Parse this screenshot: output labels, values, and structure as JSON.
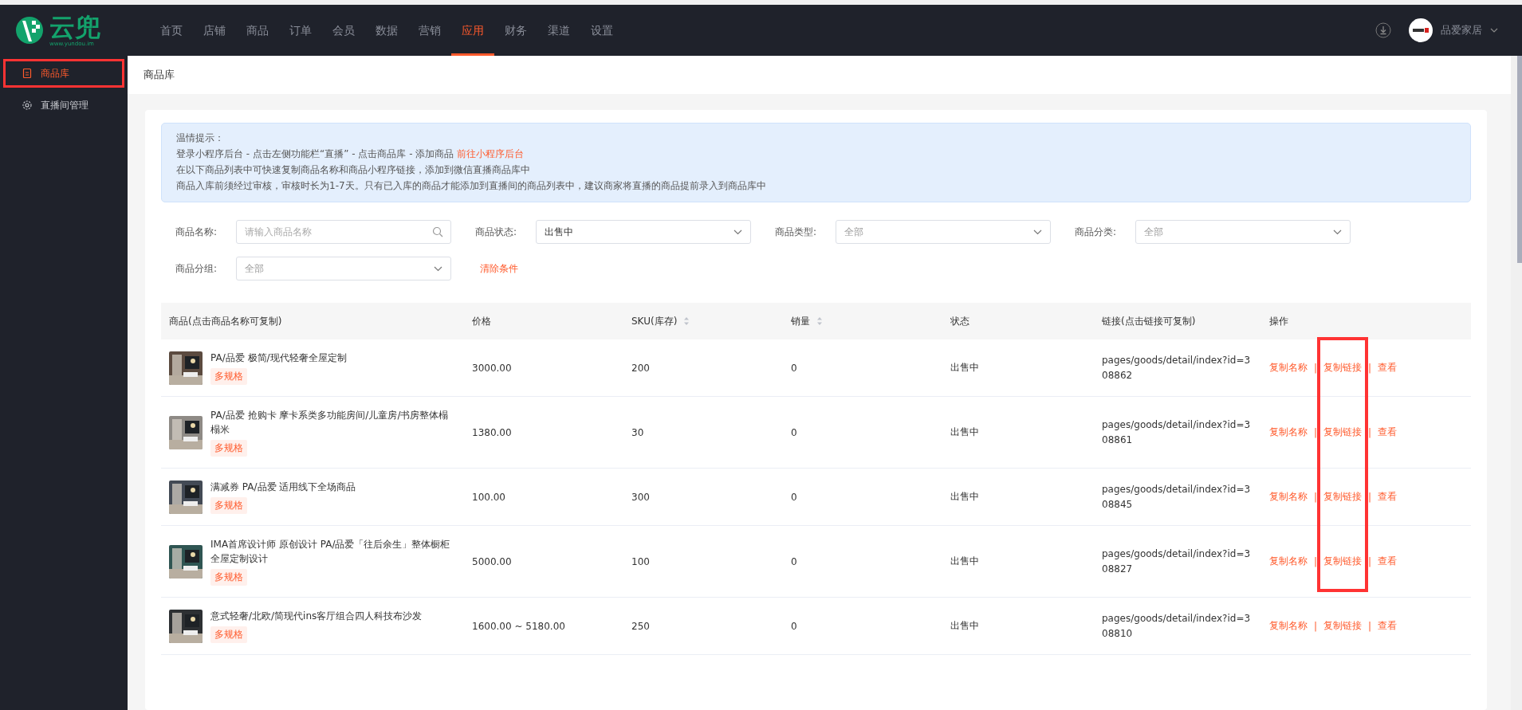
{
  "logo": {
    "name": "云兜",
    "site": "www.yundou.im"
  },
  "top_nav": [
    {
      "label": "首页",
      "selected": false
    },
    {
      "label": "店铺",
      "selected": false
    },
    {
      "label": "商品",
      "selected": false
    },
    {
      "label": "订单",
      "selected": false
    },
    {
      "label": "会员",
      "selected": false
    },
    {
      "label": "数据",
      "selected": false
    },
    {
      "label": "营销",
      "selected": false
    },
    {
      "label": "应用",
      "selected": true
    },
    {
      "label": "财务",
      "selected": false
    },
    {
      "label": "渠道",
      "selected": false
    },
    {
      "label": "设置",
      "selected": false
    }
  ],
  "account": {
    "name": "品爱家居"
  },
  "sidebar": {
    "items": [
      {
        "label": "商品库",
        "selected": true,
        "highlighted": true
      },
      {
        "label": "直播间管理",
        "selected": false,
        "highlighted": false
      }
    ]
  },
  "page_title": "商品库",
  "notice": {
    "title": "温情提示：",
    "lines": [
      {
        "text": "登录小程序后台 - 点击左侧功能栏“直播” - 点击商品库 - 添加商品",
        "link": "前往小程序后台"
      },
      {
        "text": "在以下商品列表中可快速复制商品名称和商品小程序链接，添加到微信直播商品库中"
      },
      {
        "text": "商品入库前须经过审核，审核时长为1-7天。只有已入库的商品才能添加到直播间的商品列表中，建议商家将直播的商品提前录入到商品库中"
      }
    ]
  },
  "filters": [
    {
      "label": "商品名称:",
      "kind": "search",
      "placeholder": "请输入商品名称"
    },
    {
      "label": "商品状态:",
      "kind": "select",
      "value": "出售中"
    },
    {
      "label": "商品类型:",
      "kind": "select",
      "placeholder": "全部"
    },
    {
      "label": "商品分类:",
      "kind": "select",
      "placeholder": "全部"
    },
    {
      "label": "商品分组:",
      "kind": "select",
      "placeholder": "全部"
    }
  ],
  "clear_filters": "清除条件",
  "table": {
    "columns": [
      {
        "label": "商品(点击商品名称可复制)",
        "sortable": false
      },
      {
        "label": "价格",
        "sortable": false
      },
      {
        "label": "SKU(库存)",
        "sortable": true
      },
      {
        "label": "销量",
        "sortable": true
      },
      {
        "label": "状态",
        "sortable": false
      },
      {
        "label": "链接(点击链接可复制)",
        "sortable": false
      },
      {
        "label": "操作",
        "sortable": false
      }
    ],
    "rows": [
      {
        "name": "PA/品爱 极简/现代轻奢全屋定制",
        "tag": "多规格",
        "price": "3000.00",
        "sku": "200",
        "sales": "0",
        "status": "出售中",
        "link": "pages/goods/detail/index?id=308862",
        "actions": [
          {
            "label": "复制名称"
          },
          {
            "label": "复制链接",
            "separator": "|"
          },
          {
            "label": "查看",
            "separator": "|"
          }
        ],
        "link_action_highlighted": true
      },
      {
        "name": "PA/品爱 抢购卡 摩卡系类多功能房间/儿童房/书房整体榻榻米",
        "tag": "多规格",
        "price": "1380.00",
        "sku": "30",
        "sales": "0",
        "status": "出售中",
        "link": "pages/goods/detail/index?id=308861",
        "actions": [
          {
            "label": "复制名称"
          },
          {
            "label": "复制链接",
            "separator": "|"
          },
          {
            "label": "查看",
            "separator": "|"
          }
        ],
        "link_action_highlighted": true
      },
      {
        "name": "满减券 PA/品爱 适用线下全场商品",
        "tag": "多规格",
        "price": "100.00",
        "sku": "300",
        "sales": "0",
        "status": "出售中",
        "link": "pages/goods/detail/index?id=308845",
        "actions": [
          {
            "label": "复制名称"
          },
          {
            "label": "复制链接",
            "separator": "|"
          },
          {
            "label": "查看",
            "separator": "|"
          }
        ],
        "link_action_highlighted": true
      },
      {
        "name": "IMA首席设计师 原创设计 PA/品爱「往后余生」整体橱柜全屋定制设计",
        "tag": "多规格",
        "price": "5000.00",
        "sku": "100",
        "sales": "0",
        "status": "出售中",
        "link": "pages/goods/detail/index?id=308827",
        "actions": [
          {
            "label": "复制名称"
          },
          {
            "label": "复制链接",
            "separator": "|"
          },
          {
            "label": "查看",
            "separator": "|"
          }
        ],
        "link_action_highlighted": true
      },
      {
        "name": "意式轻奢/北欧/简现代ins客厅组合四人科技布沙发",
        "tag": "多规格",
        "price": "1600.00 ~ 5180.00",
        "sku": "250",
        "sales": "0",
        "status": "出售中",
        "link": "pages/goods/detail/index?id=308810",
        "actions": [
          {
            "label": "复制名称"
          },
          {
            "label": "复制链接",
            "separator": "|"
          },
          {
            "label": "查看",
            "separator": "|"
          }
        ],
        "link_action_highlighted": false
      }
    ]
  }
}
